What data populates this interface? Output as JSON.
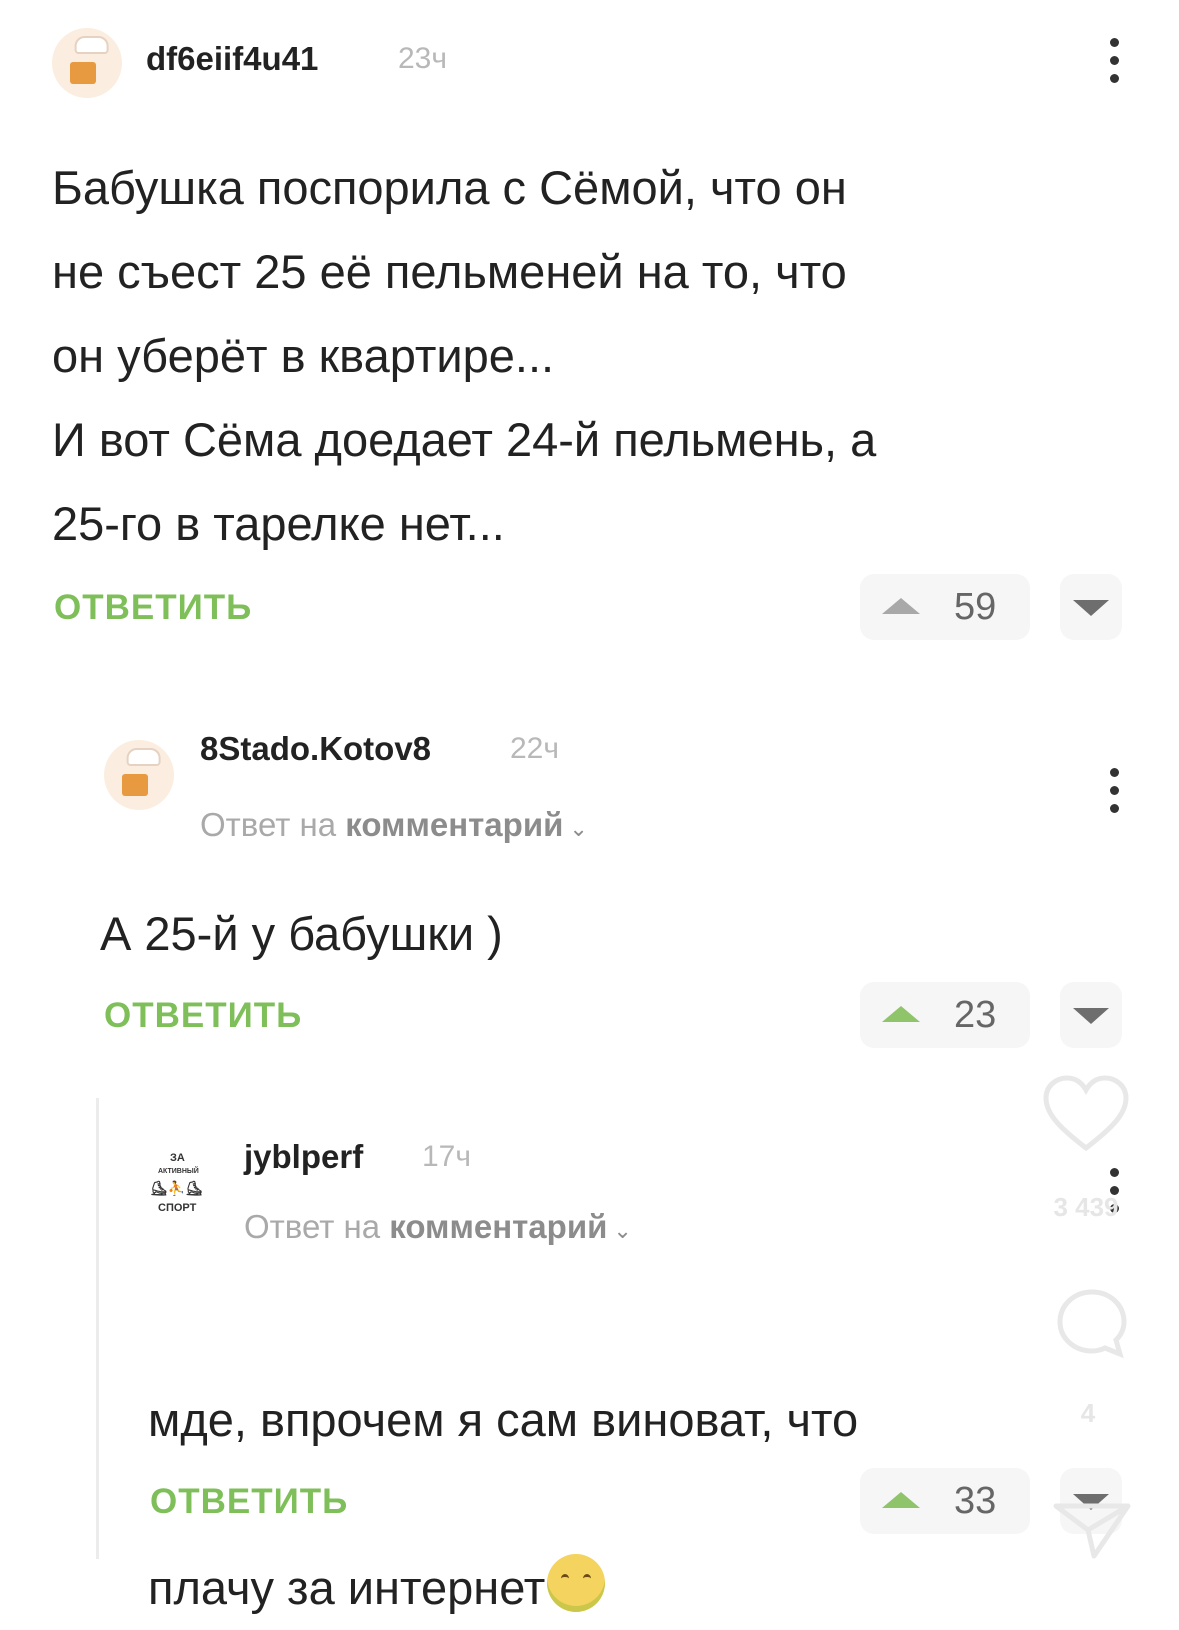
{
  "comments": [
    {
      "username": "df6eiif4u41",
      "time": "23ч",
      "text": "Бабушка поспорила с Сёмой, что он\nне съест 25 её пельменей на то, что\nон уберёт в квартире...\nИ вот Сёма доедает 24-й пельмень, а\n25-го в тарелке нет...",
      "reply_label": "ОТВЕТИТЬ",
      "votes": "59"
    },
    {
      "username": "8Stado.Kotov8",
      "time": "22ч",
      "reply_to_prefix": "Ответ на",
      "reply_to_link": "комментарий",
      "text": "А 25-й у бабушки )",
      "reply_label": "ОТВЕТИТЬ",
      "votes": "23"
    },
    {
      "username": "jyblperf",
      "time": "17ч",
      "reply_to_prefix": "Ответ на",
      "reply_to_link": "комментарий",
      "text_line1": "мде, впрочем я сам виноват, что",
      "text_line2": "плачу за интернет",
      "reply_label": "ОТВЕТИТЬ",
      "votes": "33"
    }
  ],
  "avatar_logo": {
    "line1": "ЗА",
    "line2": "АКТИВНЫЙ",
    "line3": "СПОРТ"
  },
  "overlay": {
    "like_count": "3 439",
    "comment_count": "4",
    "icons": [
      "heart-icon",
      "comment-icon",
      "send-icon"
    ]
  },
  "colors": {
    "accent_green": "#7fbf5a",
    "text": "#222222",
    "muted": "#a9a9a9"
  }
}
